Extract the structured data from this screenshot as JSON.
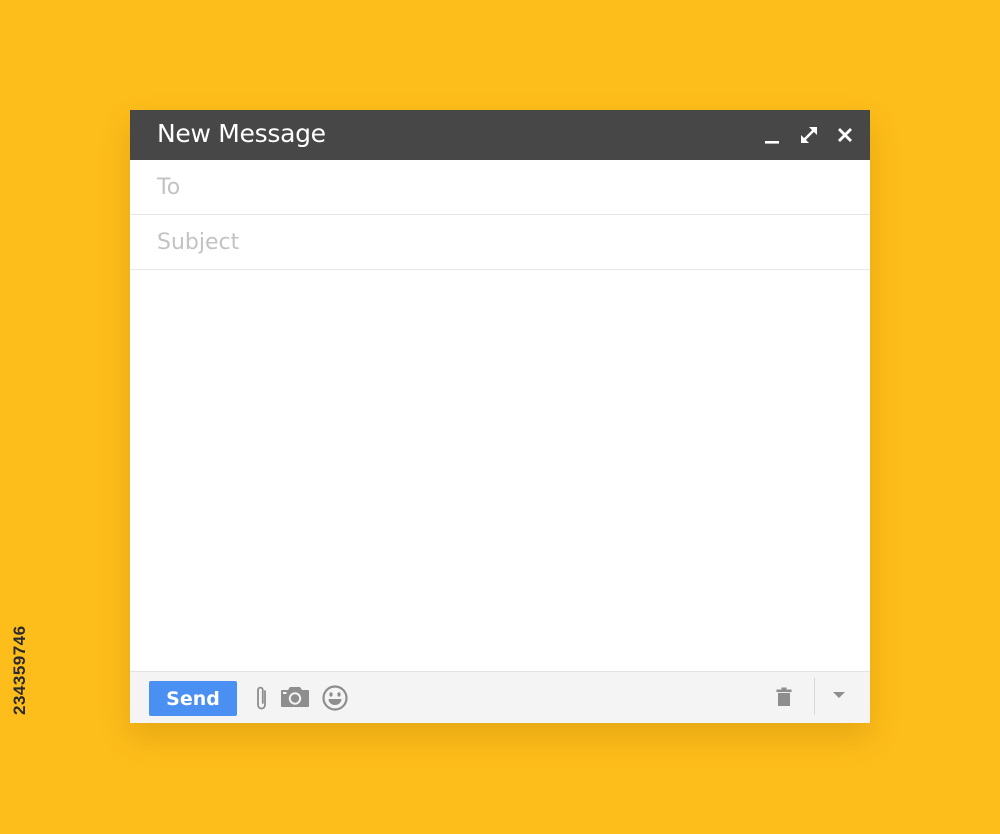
{
  "window": {
    "title": "New Message",
    "controls": {
      "minimize_icon": "minimize-icon",
      "maximize_icon": "expand-icon",
      "close_icon": "close-icon"
    }
  },
  "fields": {
    "to": {
      "value": "",
      "placeholder": "To"
    },
    "subject": {
      "value": "",
      "placeholder": "Subject"
    },
    "body": {
      "value": ""
    }
  },
  "toolbar": {
    "send_label": "Send",
    "icons": [
      "paperclip-icon",
      "camera-icon",
      "emoji-icon",
      "trash-icon",
      "chevron-down-icon"
    ]
  },
  "watermark_id": "234359746",
  "colors": {
    "background": "#FDBD1A",
    "titlebar": "#474747",
    "send_button": "#4A8FF2",
    "footer": "#F4F4F4",
    "icon_gray": "#8E8E8E"
  }
}
